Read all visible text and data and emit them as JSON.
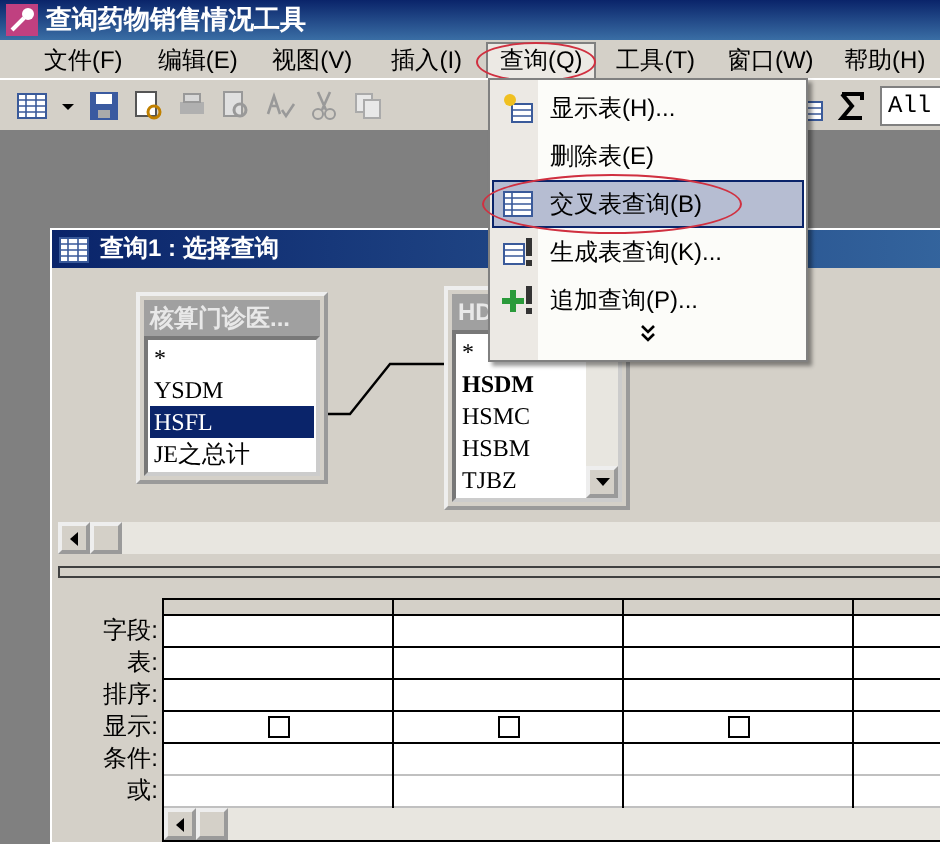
{
  "app_title": "查询药物销售情况工具",
  "menu_bar": [
    {
      "label": "文件(F)",
      "open": false,
      "circled": false
    },
    {
      "label": "编辑(E)",
      "open": false,
      "circled": false
    },
    {
      "label": "视图(V)",
      "open": false,
      "circled": false
    },
    {
      "label": "插入(I)",
      "open": false,
      "circled": false
    },
    {
      "label": "查询(Q)",
      "open": true,
      "circled": true
    },
    {
      "label": "工具(T)",
      "open": false,
      "circled": false
    },
    {
      "label": "窗口(W)",
      "open": false,
      "circled": false
    },
    {
      "label": "帮助(H)",
      "open": false,
      "circled": false
    }
  ],
  "toolbar": {
    "combo_value": "All"
  },
  "query_menu": {
    "items": [
      {
        "kind": "item",
        "label": "显示表(H)...",
        "highlighted": false,
        "circled": false
      },
      {
        "kind": "item",
        "label": "删除表(E)",
        "highlighted": false,
        "circled": false
      },
      {
        "kind": "item",
        "label": "交叉表查询(B)",
        "highlighted": true,
        "circled": true
      },
      {
        "kind": "item",
        "label": "生成表查询(K)...",
        "highlighted": false,
        "circled": false
      },
      {
        "kind": "item",
        "label": "追加查询(P)...",
        "highlighted": false,
        "circled": false
      },
      {
        "kind": "expand"
      }
    ]
  },
  "query_window": {
    "title": "查询1 : 选择查询",
    "tables": [
      {
        "title": "核算门诊医...",
        "fields": [
          {
            "name": "*",
            "selected": false,
            "bold": false
          },
          {
            "name": "YSDM",
            "selected": false,
            "bold": false
          },
          {
            "name": "HSFL",
            "selected": true,
            "bold": false
          },
          {
            "name": "JE之总计",
            "selected": false,
            "bold": false
          }
        ],
        "scrollbar": false
      },
      {
        "title": "HD",
        "fields": [
          {
            "name": "*",
            "selected": false,
            "bold": false
          },
          {
            "name": "HSDM",
            "selected": false,
            "bold": true
          },
          {
            "name": "HSMC",
            "selected": false,
            "bold": false
          },
          {
            "name": "HSBM",
            "selected": false,
            "bold": false
          },
          {
            "name": "TJBZ",
            "selected": false,
            "bold": false
          }
        ],
        "scrollbar": true
      }
    ]
  },
  "grid": {
    "row_labels": [
      "字段:",
      "表:",
      "排序:",
      "显示:",
      "条件:",
      "或:"
    ],
    "columns": [
      {
        "show_checked": false
      },
      {
        "show_checked": false
      },
      {
        "show_checked": false
      },
      {}
    ]
  }
}
